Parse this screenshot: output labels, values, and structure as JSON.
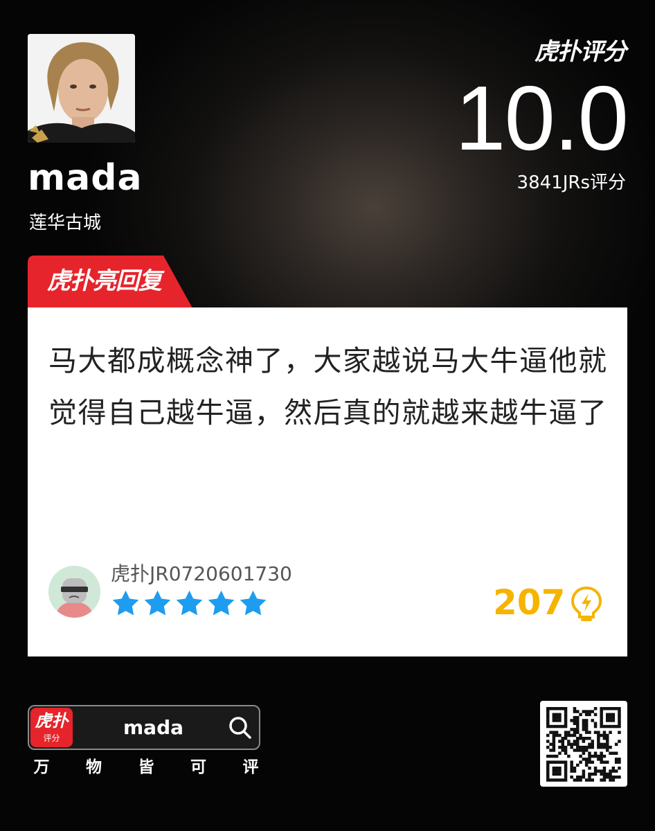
{
  "profile": {
    "name": "mada",
    "team": "莲华古城"
  },
  "rating": {
    "brand": "虎扑评分",
    "score": "10.0",
    "count_text": "3841JRs评分"
  },
  "tab": {
    "label": "虎扑亮回复",
    "color": "#e6242b"
  },
  "comment": {
    "text": "马大都成概念神了，大家越说马大牛逼他就觉得自己越牛逼，然后真的就越来越牛逼了",
    "user": "虎扑JR0720601730",
    "stars": 5,
    "star_color": "#1e9cf0",
    "likes": "207",
    "like_color": "#f5b400"
  },
  "search": {
    "app_icon_main": "虎扑",
    "app_icon_sub": "评分",
    "query": "mada"
  },
  "slogan": [
    "万",
    "物",
    "皆",
    "可",
    "评"
  ]
}
